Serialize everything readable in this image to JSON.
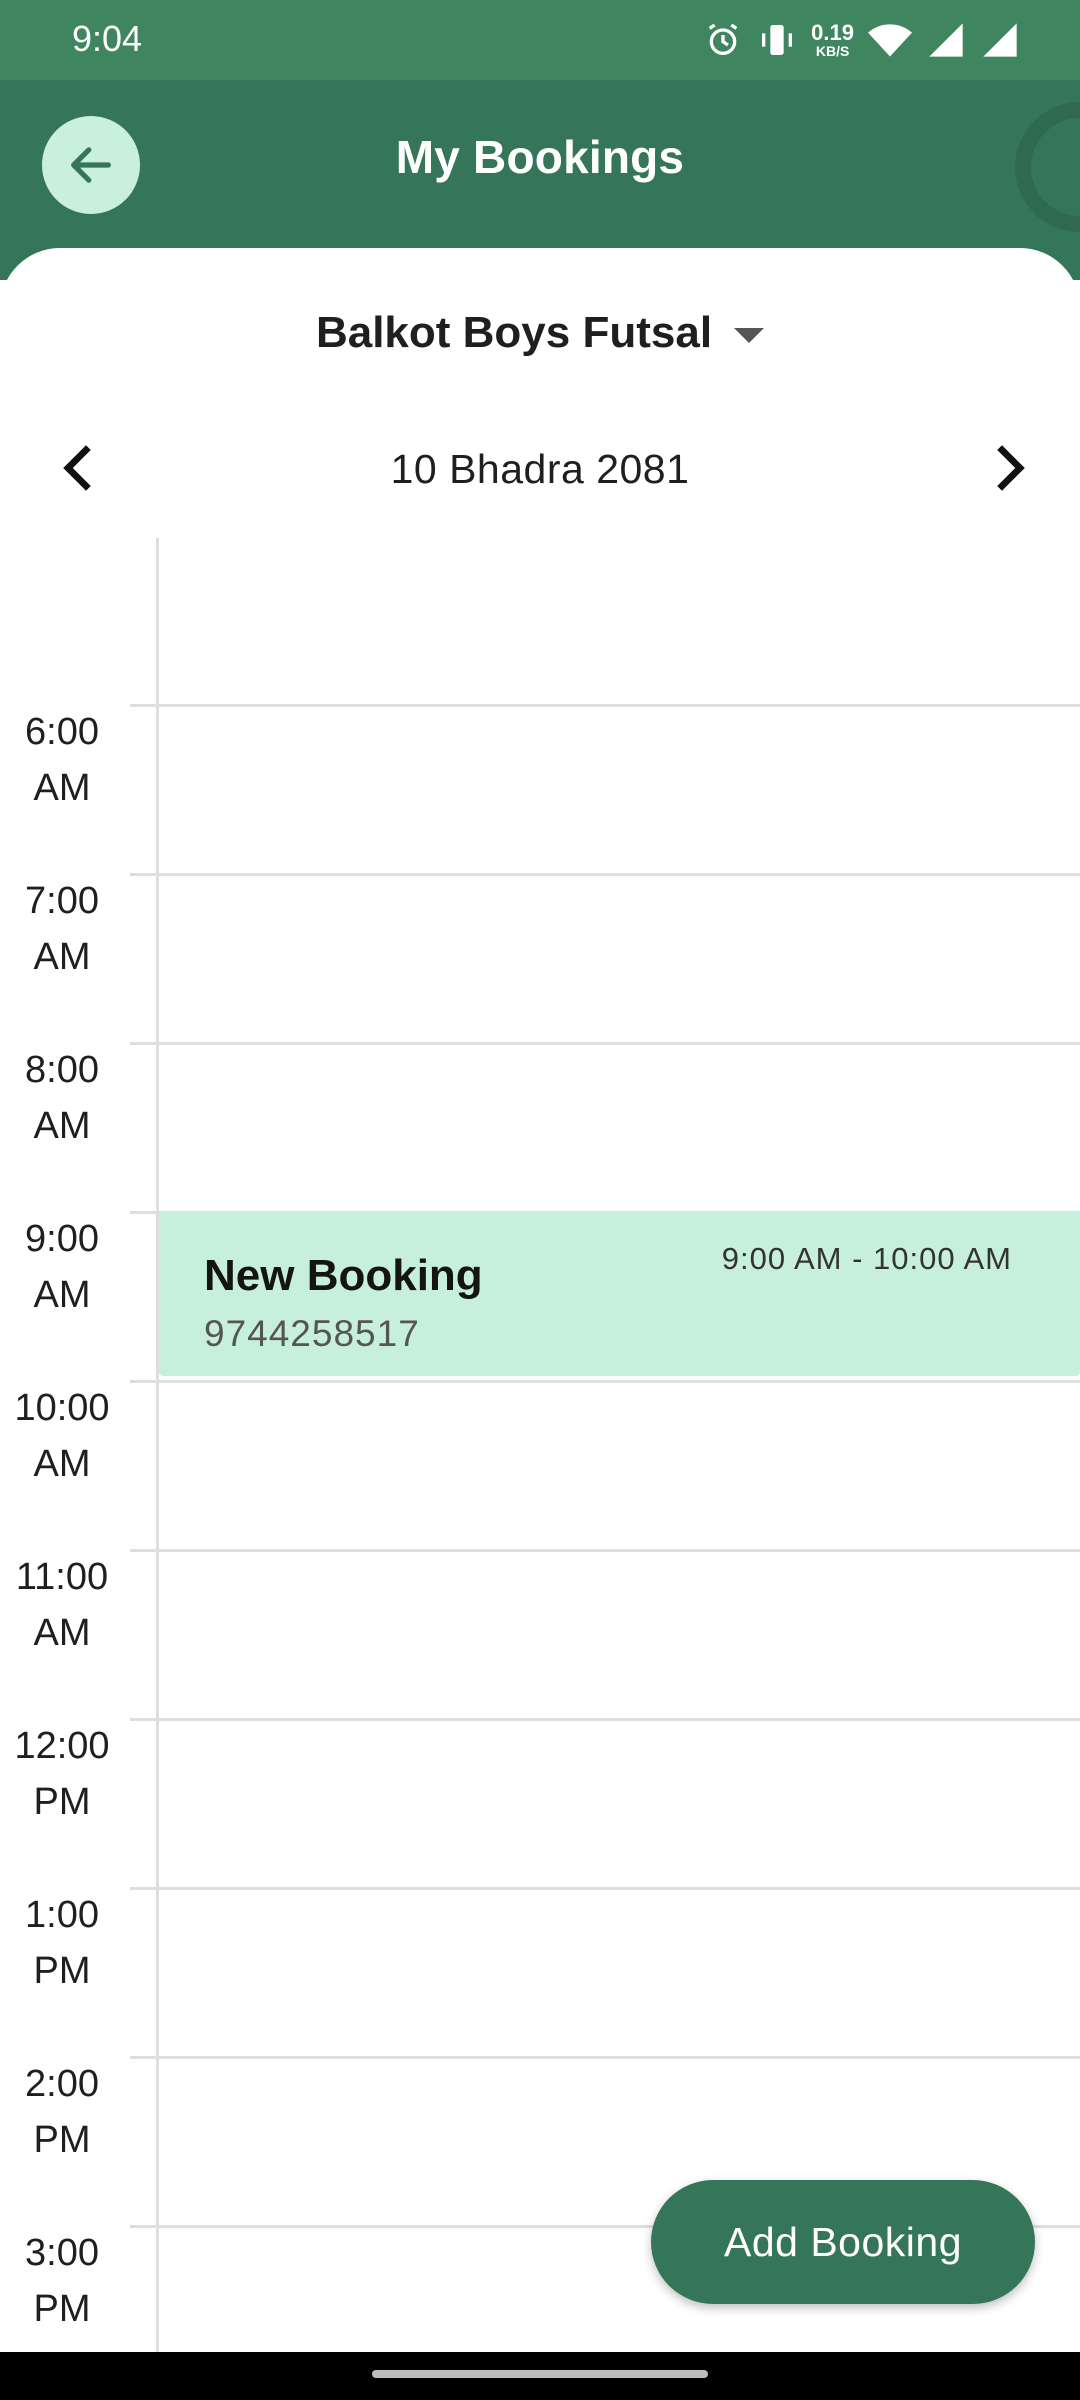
{
  "status_bar": {
    "time": "9:04",
    "net_speed_value": "0.19",
    "net_speed_unit": "KB/S"
  },
  "header": {
    "title": "My Bookings"
  },
  "venue": {
    "name": "Balkot Boys Futsal"
  },
  "date_nav": {
    "date": "10 Bhadra 2081"
  },
  "timeline": {
    "hours": [
      {
        "time": "6:00",
        "period": "AM"
      },
      {
        "time": "7:00",
        "period": "AM"
      },
      {
        "time": "8:00",
        "period": "AM"
      },
      {
        "time": "9:00",
        "period": "AM"
      },
      {
        "time": "10:00",
        "period": "AM"
      },
      {
        "time": "11:00",
        "period": "AM"
      },
      {
        "time": "12:00",
        "period": "PM"
      },
      {
        "time": "1:00",
        "period": "PM"
      },
      {
        "time": "2:00",
        "period": "PM"
      },
      {
        "time": "3:00",
        "period": "PM"
      }
    ],
    "events": [
      {
        "title": "New Booking",
        "phone": "9744258517",
        "time_range": "9:00 AM - 10:00 AM"
      }
    ]
  },
  "actions": {
    "add_booking_label": "Add Booking"
  },
  "colors": {
    "status_bar": "#3f8660",
    "header": "#35765a",
    "accent_light": "#c9f0dd",
    "event_bg": "#c7f0dc"
  }
}
